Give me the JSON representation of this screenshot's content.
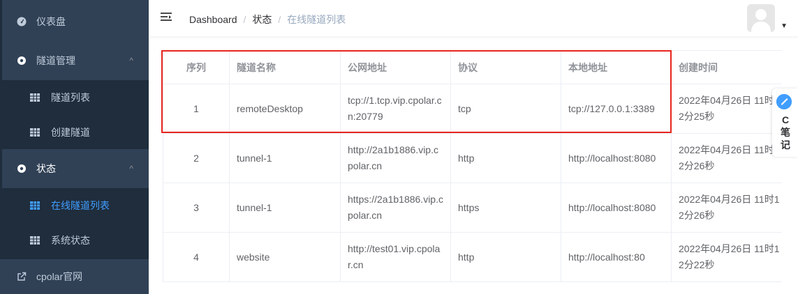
{
  "sidebar": {
    "items": [
      {
        "label": "仪表盘",
        "icon": "dashboard-icon"
      },
      {
        "label": "隧道管理",
        "icon": "circle-icon",
        "arrow": "^"
      },
      {
        "label": "隧道列表",
        "icon": "grid-icon"
      },
      {
        "label": "创建隧道",
        "icon": "grid-icon"
      },
      {
        "label": "状态",
        "icon": "circle-icon",
        "arrow": "^"
      },
      {
        "label": "在线隧道列表",
        "icon": "grid-icon"
      },
      {
        "label": "系统状态",
        "icon": "grid-icon"
      },
      {
        "label": "cpolar官网",
        "icon": "external-link-icon"
      }
    ]
  },
  "breadcrumb": {
    "home": "Dashboard",
    "sep": "/",
    "level1": "状态",
    "level2": "在线隧道列表"
  },
  "table": {
    "headers": [
      "序列",
      "隧道名称",
      "公网地址",
      "协议",
      "本地地址",
      "创建时间"
    ],
    "rows": [
      [
        "1",
        "remoteDesktop",
        "tcp://1.tcp.vip.cpolar.cn:20779",
        "tcp",
        "tcp://127.0.0.1:3389",
        "2022年04月26日 11时12分25秒"
      ],
      [
        "2",
        "tunnel-1",
        "http://2a1b1886.vip.cpolar.cn",
        "http",
        "http://localhost:8080",
        "2022年04月26日 11时12分26秒"
      ],
      [
        "3",
        "tunnel-1",
        "https://2a1b1886.vip.cpolar.cn",
        "https",
        "http://localhost:8080",
        "2022年04月26日 11时12分26秒"
      ],
      [
        "4",
        "website",
        "http://test01.vip.cpolar.cn",
        "http",
        "http://localhost:80",
        "2022年04月26日 11时12分22秒"
      ]
    ]
  },
  "note_widget": {
    "text": "C笔记"
  },
  "colors": {
    "sidebar_bg": "#304156",
    "submenu_bg": "#1f2d3d",
    "active": "#409EFF",
    "highlight": "#e8251e"
  }
}
